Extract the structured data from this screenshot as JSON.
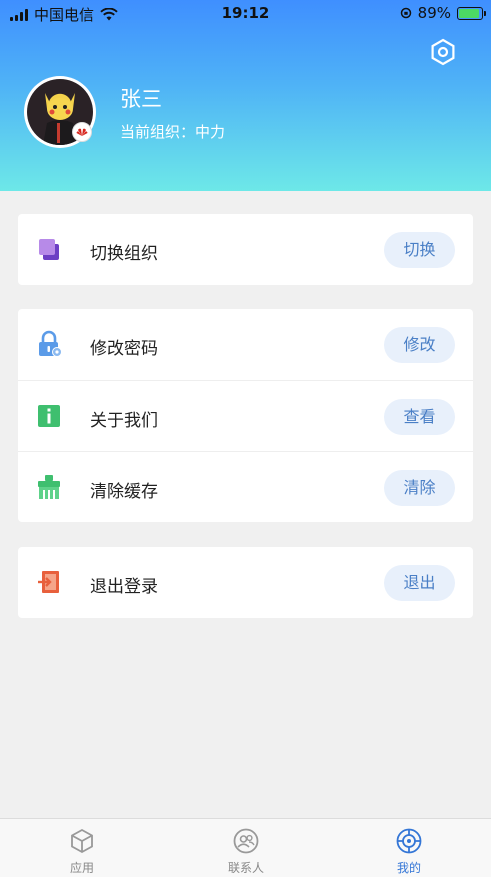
{
  "status_bar": {
    "carrier": "中国电信",
    "time": "19:12",
    "battery_percent": "89%"
  },
  "profile": {
    "name": "张三",
    "org_label": "当前组织：",
    "org_name": "中力"
  },
  "menu_groups": [
    [
      {
        "label": "切换组织",
        "action": "切换",
        "icon": "switch-org-icon"
      }
    ],
    [
      {
        "label": "修改密码",
        "action": "修改",
        "icon": "lock-icon"
      },
      {
        "label": "关于我们",
        "action": "查看",
        "icon": "info-icon"
      },
      {
        "label": "清除缓存",
        "action": "清除",
        "icon": "broom-icon"
      }
    ],
    [
      {
        "label": "退出登录",
        "action": "退出",
        "icon": "logout-icon"
      }
    ]
  ],
  "tabs": [
    {
      "label": "应用",
      "icon": "cube-icon",
      "active": false
    },
    {
      "label": "联系人",
      "icon": "contacts-icon",
      "active": false
    },
    {
      "label": "我的",
      "icon": "target-icon",
      "active": true
    }
  ],
  "colors": {
    "accent": "#3476d6",
    "button_bg": "#e8f0fb",
    "button_text": "#4a7fc6",
    "header_gradient_top": "#3f8fff",
    "header_gradient_bottom": "#6de8e8"
  }
}
